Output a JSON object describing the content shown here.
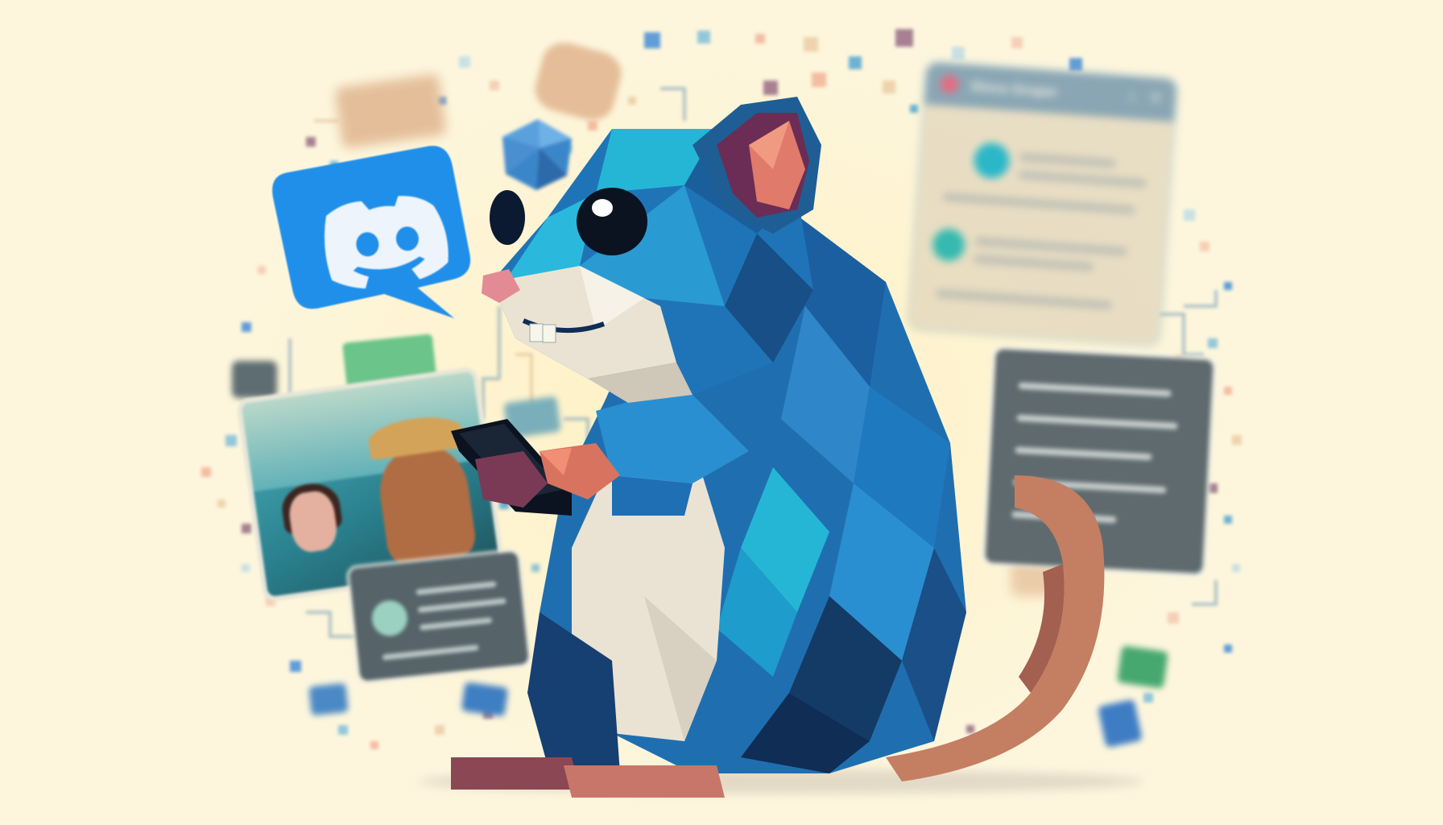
{
  "scene": {
    "subject": "rat-with-phone",
    "palette": {
      "background": "#fdf6dd",
      "rat_blue": "#1f6fb0",
      "rat_teal": "#25b6d6",
      "rat_dark": "#143a66",
      "belly": "#eae3d4",
      "ear_inner": "#e07a6a",
      "nose": "#e38b94",
      "discord_blue": "#1f8fea",
      "tail": "#c47e62"
    }
  },
  "discord_bubble": {
    "icon": "discord-logo-icon"
  },
  "chat_window": {
    "title": "Discu Gruper",
    "controls": [
      "↕",
      "✕"
    ]
  },
  "icons": [
    "envelope-icon",
    "discord-logo-icon",
    "polyhedron-icon",
    "chat-bubble-icon",
    "phone-icon"
  ]
}
